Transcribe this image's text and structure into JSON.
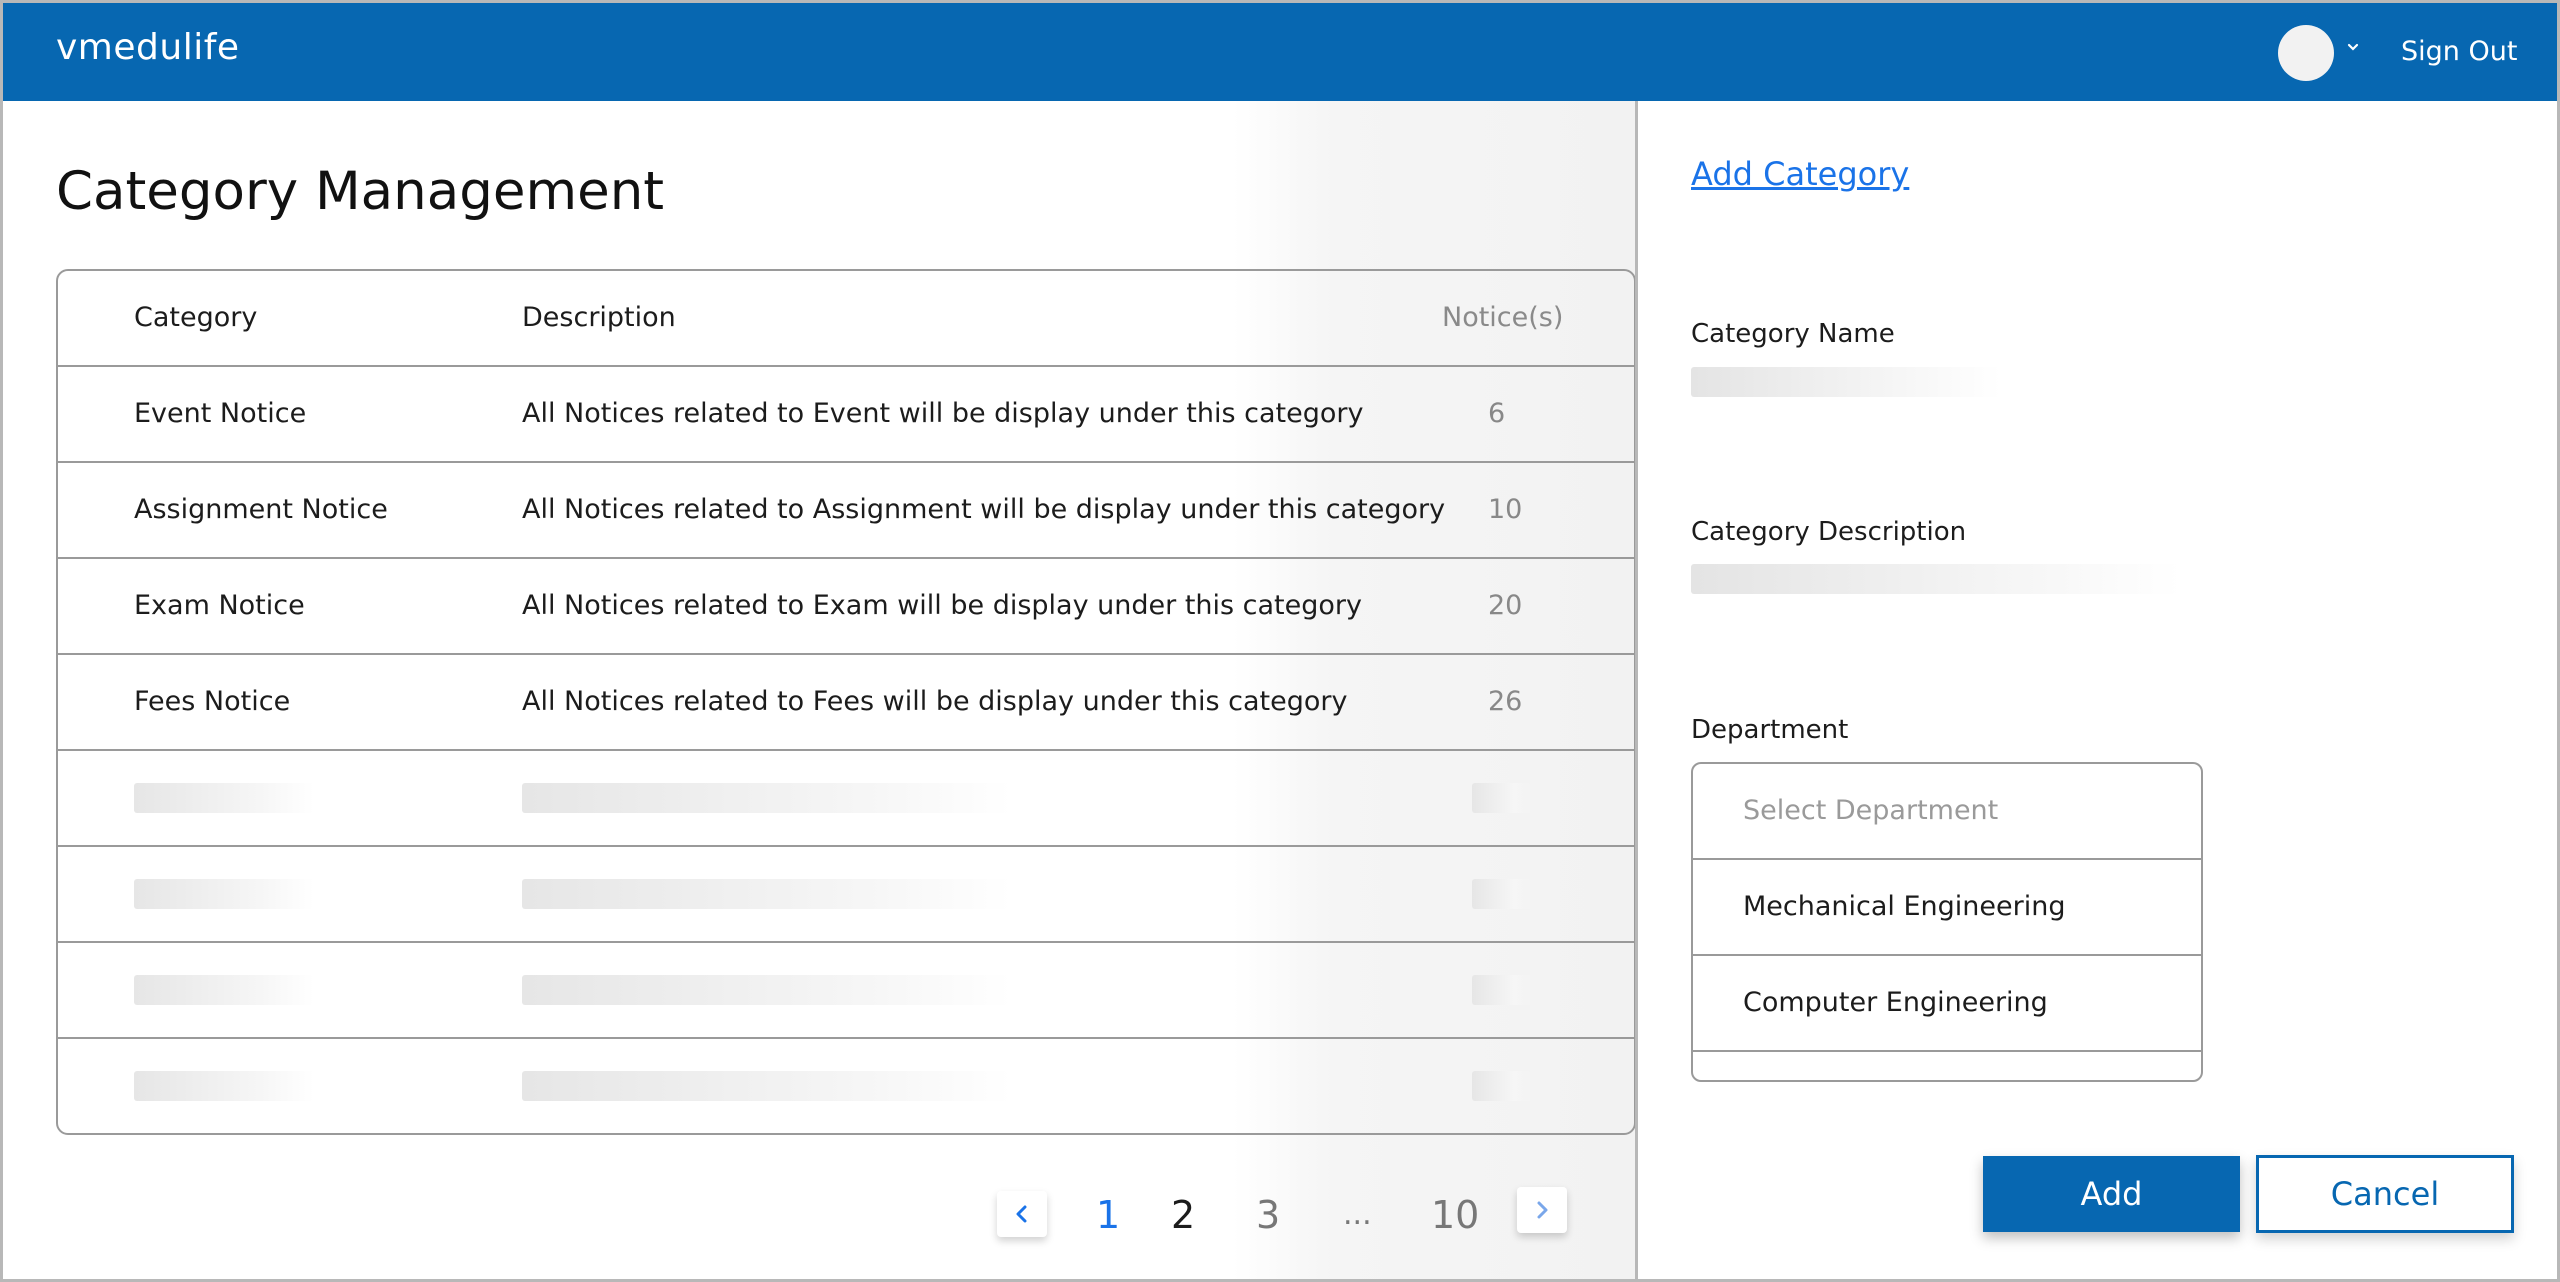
{
  "header": {
    "brand": "vmedulife",
    "signout_label": "Sign Out"
  },
  "main": {
    "title": "Category Management",
    "table": {
      "columns": [
        "Category",
        "Description",
        "Notice(s)"
      ],
      "rows": [
        {
          "category": "Event Notice",
          "description": "All Notices related to Event will be display under this category",
          "count": "6"
        },
        {
          "category": "Assignment Notice",
          "description": "All Notices related to Assignment will be display under this category",
          "count": "10"
        },
        {
          "category": "Exam Notice",
          "description": "All Notices related to Exam will be display under this category",
          "count": "20"
        },
        {
          "category": "Fees Notice",
          "description": "All Notices related to Fees will be display under this category",
          "count": "26"
        }
      ]
    },
    "pagination": {
      "pages": [
        "1",
        "2",
        "3",
        "...",
        "10"
      ],
      "prev_icon": "chevron-left-icon",
      "next_icon": "chevron-right-icon"
    }
  },
  "panel": {
    "title": "Add Category",
    "category_name_label": "Category Name",
    "category_description_label": "Category Description",
    "department_label": "Department",
    "department_placeholder": "Select Department",
    "department_options": [
      "Mechanical Engineering",
      "Computer Engineering"
    ],
    "add_label": "Add",
    "cancel_label": "Cancel"
  },
  "colors": {
    "brand": "#0767b1",
    "link": "#1a73e8"
  }
}
